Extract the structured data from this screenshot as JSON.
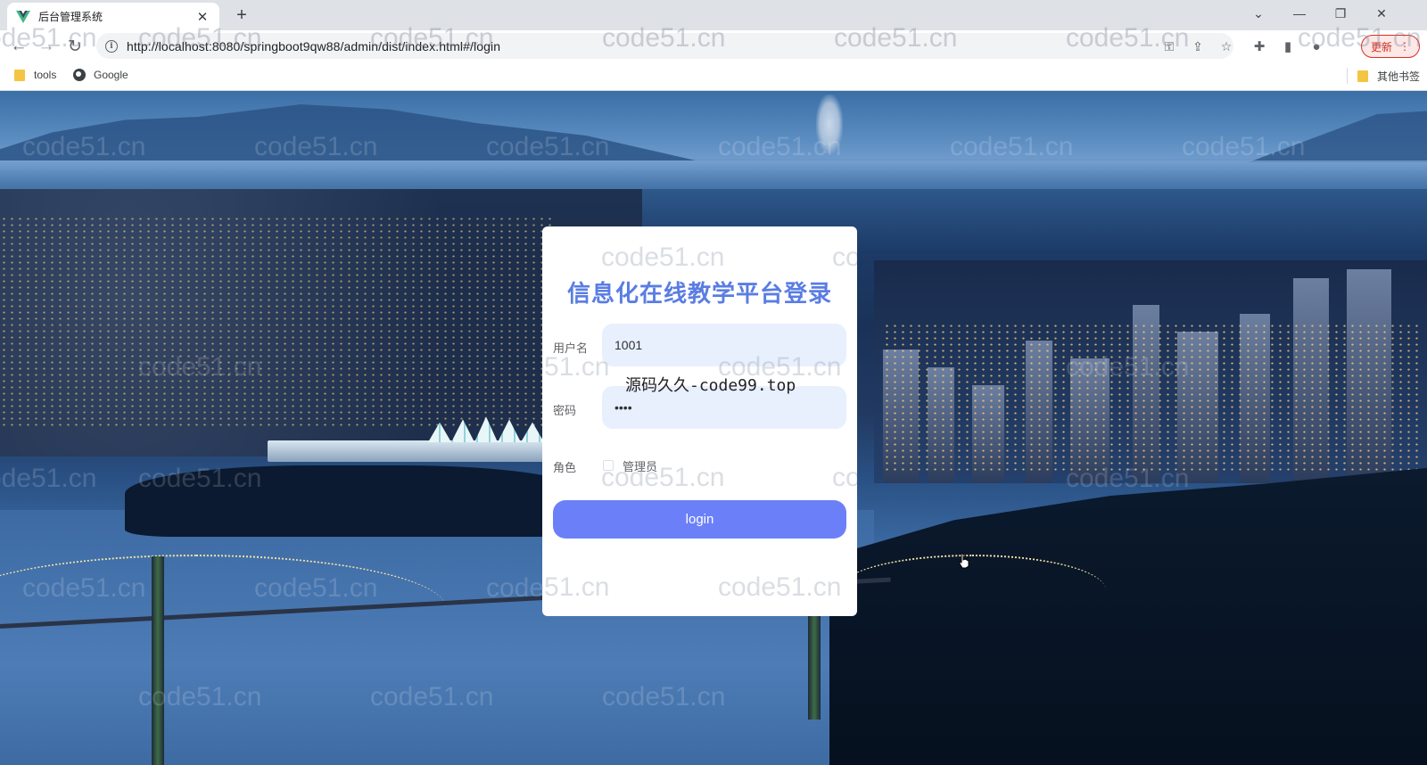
{
  "browser": {
    "tab_title": "后台管理系统",
    "url": "http://localhost:8080/springboot9qw88/admin/dist/index.html#/login",
    "update_label": "更新",
    "bookmarks": [
      {
        "label": "tools"
      },
      {
        "label": "Google"
      }
    ],
    "other_bookmarks": "其他书签"
  },
  "login": {
    "title": "信息化在线教学平台登录",
    "username_label": "用户名",
    "username_value": "1001",
    "password_label": "密码",
    "password_value": "1234",
    "role_label": "角色",
    "role_option": "管理员",
    "login_button": "login"
  },
  "overlay_text": "源码久久-code99.top",
  "watermark": "code51.cn",
  "colors": {
    "accent": "#6b80f8",
    "title": "#5a7de3",
    "input_bg": "#e8f0fe"
  }
}
